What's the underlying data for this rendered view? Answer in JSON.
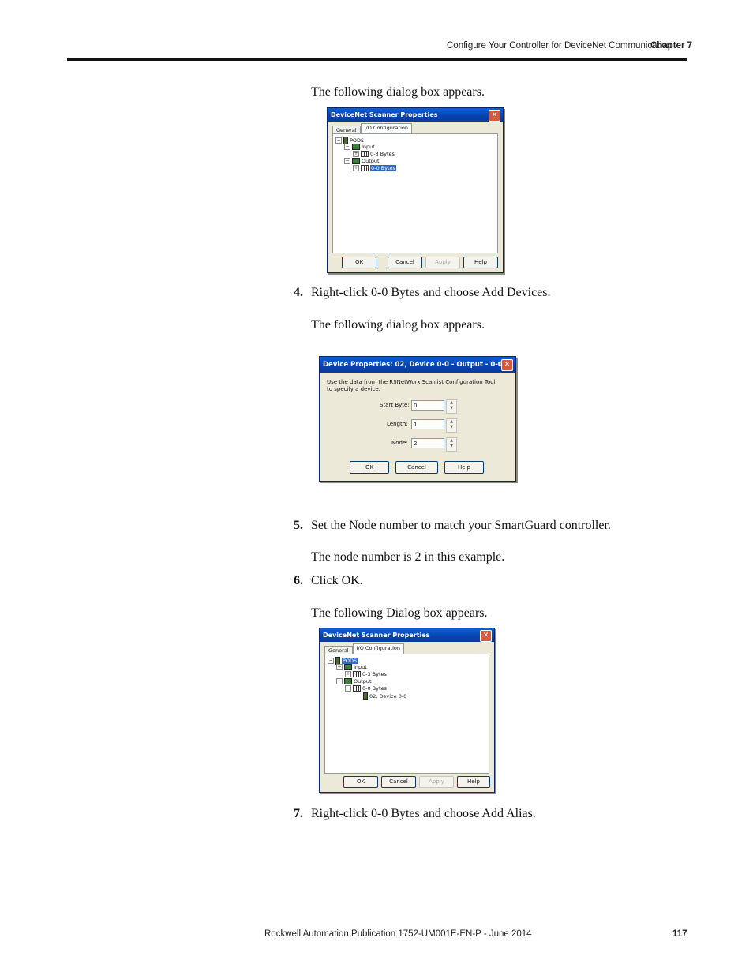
{
  "header": {
    "section": "Configure Your Controller for DeviceNet Communication",
    "chapter": "Chapter 7"
  },
  "text": {
    "p1": "The following dialog box appears.",
    "step4_num": "4.",
    "step4": "Right-click 0-0 Bytes and choose Add Devices.",
    "p2": "The following dialog box appears.",
    "step5_num": "5.",
    "step5": "Set the Node number to match your SmartGuard controller.",
    "p3": "The node number is 2 in this example.",
    "step6_num": "6.",
    "step6": "Click OK.",
    "p4": "The following Dialog box appears.",
    "step7_num": "7.",
    "step7": "Right-click 0-0 Bytes and choose Add Alias."
  },
  "dialog1": {
    "title": "DeviceNet Scanner Properties",
    "tabs": [
      "General",
      "I/O Configuration"
    ],
    "tree": {
      "root": "PODS",
      "input": "Input",
      "input_bytes": "0-3 Bytes",
      "output": "Output",
      "output_bytes": "0-0 Bytes"
    },
    "buttons": {
      "ok": "OK",
      "cancel": "Cancel",
      "apply": "Apply",
      "help": "Help"
    }
  },
  "dialog2": {
    "title": "Device Properties: 02, Device 0-0 - Output - 0-0 ...",
    "instruction": "Use the data from the RSNetWorx Scanlist Configuration Tool to specify a device.",
    "start_byte_label": "Start Byte:",
    "start_byte_value": "0",
    "length_label": "Length:",
    "length_value": "1",
    "node_label": "Node:",
    "node_value": "2",
    "buttons": {
      "ok": "OK",
      "cancel": "Cancel",
      "help": "Help"
    }
  },
  "dialog3": {
    "title": "DeviceNet Scanner Properties",
    "tabs": [
      "General",
      "I/O Configuration"
    ],
    "tree": {
      "root": "PODS",
      "input": "Input",
      "input_bytes": "0-3 Bytes",
      "output": "Output",
      "output_bytes": "0-0 Bytes",
      "device": "02, Device 0-0"
    },
    "buttons": {
      "ok": "OK",
      "cancel": "Cancel",
      "apply": "Apply",
      "help": "Help"
    }
  },
  "footer": {
    "publication": "Rockwell Automation Publication 1752-UM001E-EN-P - June 2014",
    "page": "117"
  }
}
